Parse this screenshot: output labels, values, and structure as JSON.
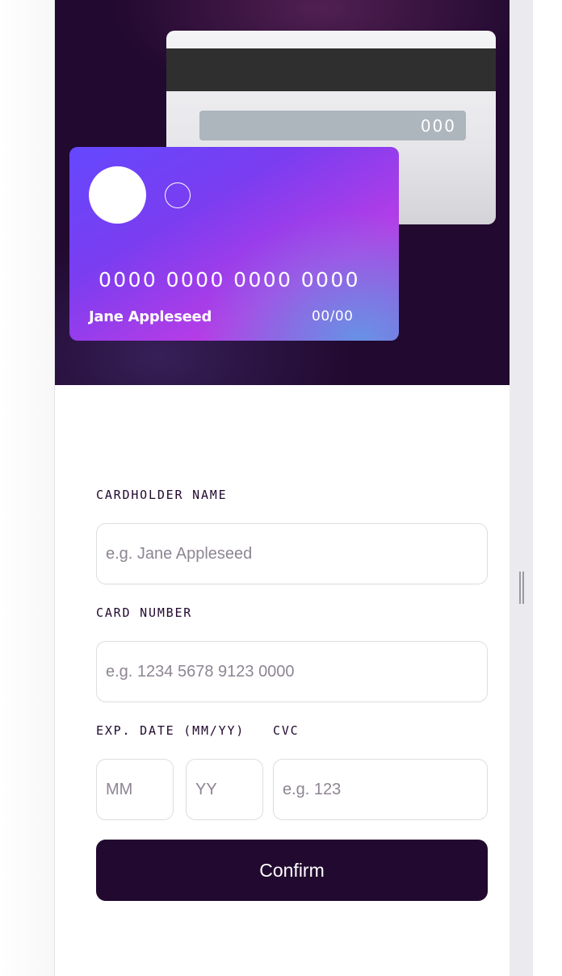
{
  "card_back": {
    "cvc": "000"
  },
  "card_front": {
    "number": "0000 0000 0000 0000",
    "name": "Jane Appleseed",
    "expiry": "00/00"
  },
  "form": {
    "cardholder_label": "CARDHOLDER NAME",
    "cardholder_placeholder": "e.g. Jane Appleseed",
    "number_label": "CARD NUMBER",
    "number_placeholder": "e.g. 1234 5678 9123 0000",
    "exp_label": "EXP. DATE (MM/YY)",
    "month_placeholder": "MM",
    "year_placeholder": "YY",
    "cvc_label": "CVC",
    "cvc_placeholder": "e.g. 123",
    "confirm_label": "Confirm"
  },
  "colors": {
    "dark_violet": "#21092f",
    "input_border": "#dedddf",
    "placeholder": "#8e8593"
  }
}
